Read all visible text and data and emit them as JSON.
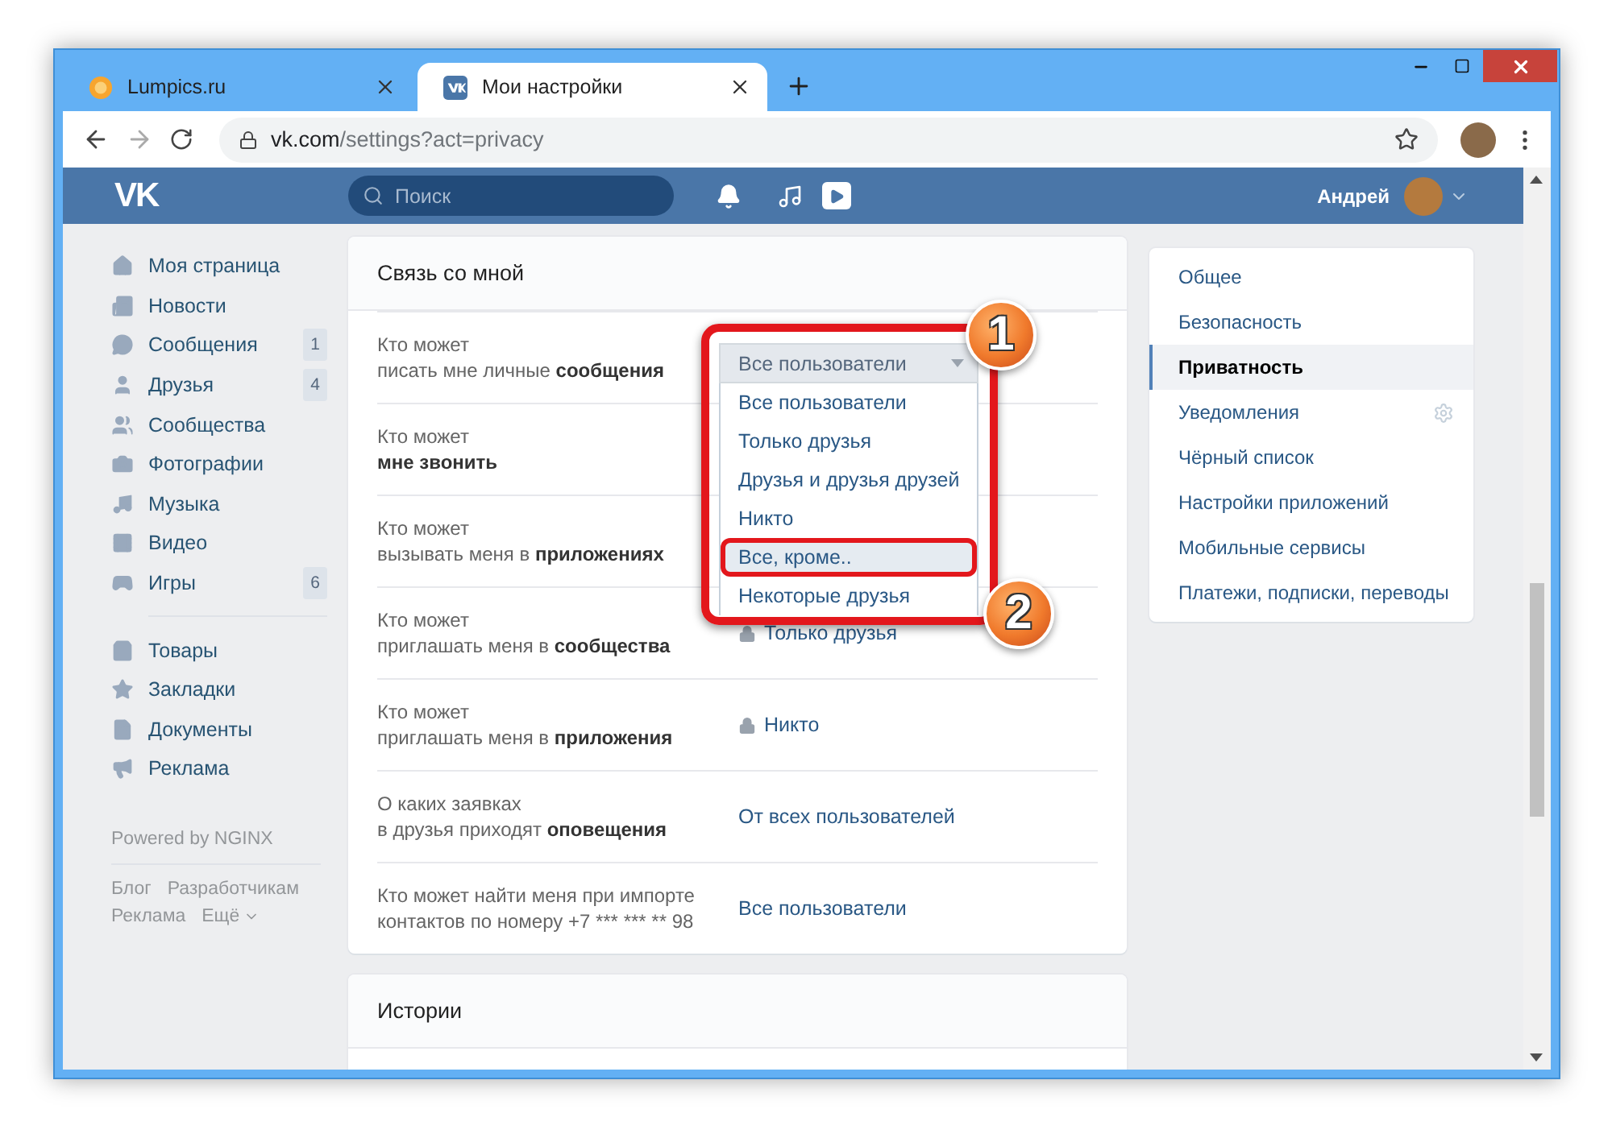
{
  "browser": {
    "tabs": [
      {
        "title": "Lumpics.ru",
        "selected": false
      },
      {
        "title": "Мои настройки",
        "selected": true
      }
    ],
    "address": {
      "host": "vk.com",
      "path": "/settings?act=privacy"
    }
  },
  "header": {
    "logo": "VK",
    "search": {
      "placeholder": "Поиск"
    },
    "user": "Андрей"
  },
  "nav": {
    "sections": [
      [
        {
          "label": "Моя страница"
        },
        {
          "label": "Новости"
        },
        {
          "label": "Сообщения",
          "count": "1"
        },
        {
          "label": "Друзья",
          "count": "4"
        },
        {
          "label": "Сообщества"
        },
        {
          "label": "Фотографии"
        },
        {
          "label": "Музыка"
        },
        {
          "label": "Видео"
        },
        {
          "label": "Игры",
          "count": "6"
        }
      ],
      [
        {
          "label": "Товары"
        },
        {
          "label": "Закладки"
        },
        {
          "label": "Документы"
        },
        {
          "label": "Реклама"
        }
      ]
    ],
    "powered": "Powered by NGINX",
    "links": [
      "Блог",
      "Разработчикам",
      "Реклама",
      "Ещё"
    ]
  },
  "settings_card": {
    "title": "Связь со мной",
    "rows": [
      {
        "label": "Кто может\nписать мне личные ",
        "label_bold": "сообщения",
        "kind": "dropdown",
        "value": "Все пользователи",
        "options": [
          {
            "label": "Все пользователи",
            "highlighted": false
          },
          {
            "label": "Только друзья",
            "highlighted": false
          },
          {
            "label": "Друзья и друзья друзей",
            "highlighted": false
          },
          {
            "label": "Никто",
            "highlighted": false
          },
          {
            "label": "Все, кроме..",
            "highlighted": true
          },
          {
            "label": "Некоторые друзья",
            "highlighted": false
          }
        ]
      },
      {
        "label": "Кто может\n",
        "label_bold": "мне звонить",
        "kind": "value"
      },
      {
        "label": "Кто может\nвызывать меня в ",
        "label_bold": "приложениях",
        "kind": "value"
      },
      {
        "label": "Кто может\nприглашать меня в ",
        "label_bold": "сообщества",
        "kind": "value",
        "value": "Только друзья",
        "locked": true
      },
      {
        "label": "Кто может\nприглашать меня в ",
        "label_bold": "приложения",
        "kind": "value",
        "value": "Никто",
        "locked": true
      },
      {
        "label": "О каких заявках\nв друзья приходят ",
        "label_bold": "оповещения",
        "kind": "value",
        "value": "От всех пользователей",
        "locked": false
      },
      {
        "label": "Кто может найти меня при импорте\nконтактов по номеру +7 *** *** ** 98",
        "kind": "value",
        "value": "Все пользователи",
        "locked": false
      }
    ]
  },
  "annotations": [
    {
      "number": "1"
    },
    {
      "number": "2"
    }
  ],
  "stories_card": {
    "title": "Истории"
  },
  "settings_menu": {
    "items": [
      {
        "label": "Общее",
        "selected": false
      },
      {
        "label": "Безопасность",
        "selected": false
      },
      {
        "label": "Приватность",
        "selected": true
      },
      {
        "label": "Уведомления",
        "selected": false,
        "gear": true
      },
      {
        "label": "Чёрный список",
        "selected": false
      },
      {
        "label": "Настройки приложений",
        "selected": false
      },
      {
        "label": "Мобильные сервисы",
        "selected": false
      },
      {
        "label": "Платежи, подписки, переводы",
        "selected": false
      }
    ]
  }
}
